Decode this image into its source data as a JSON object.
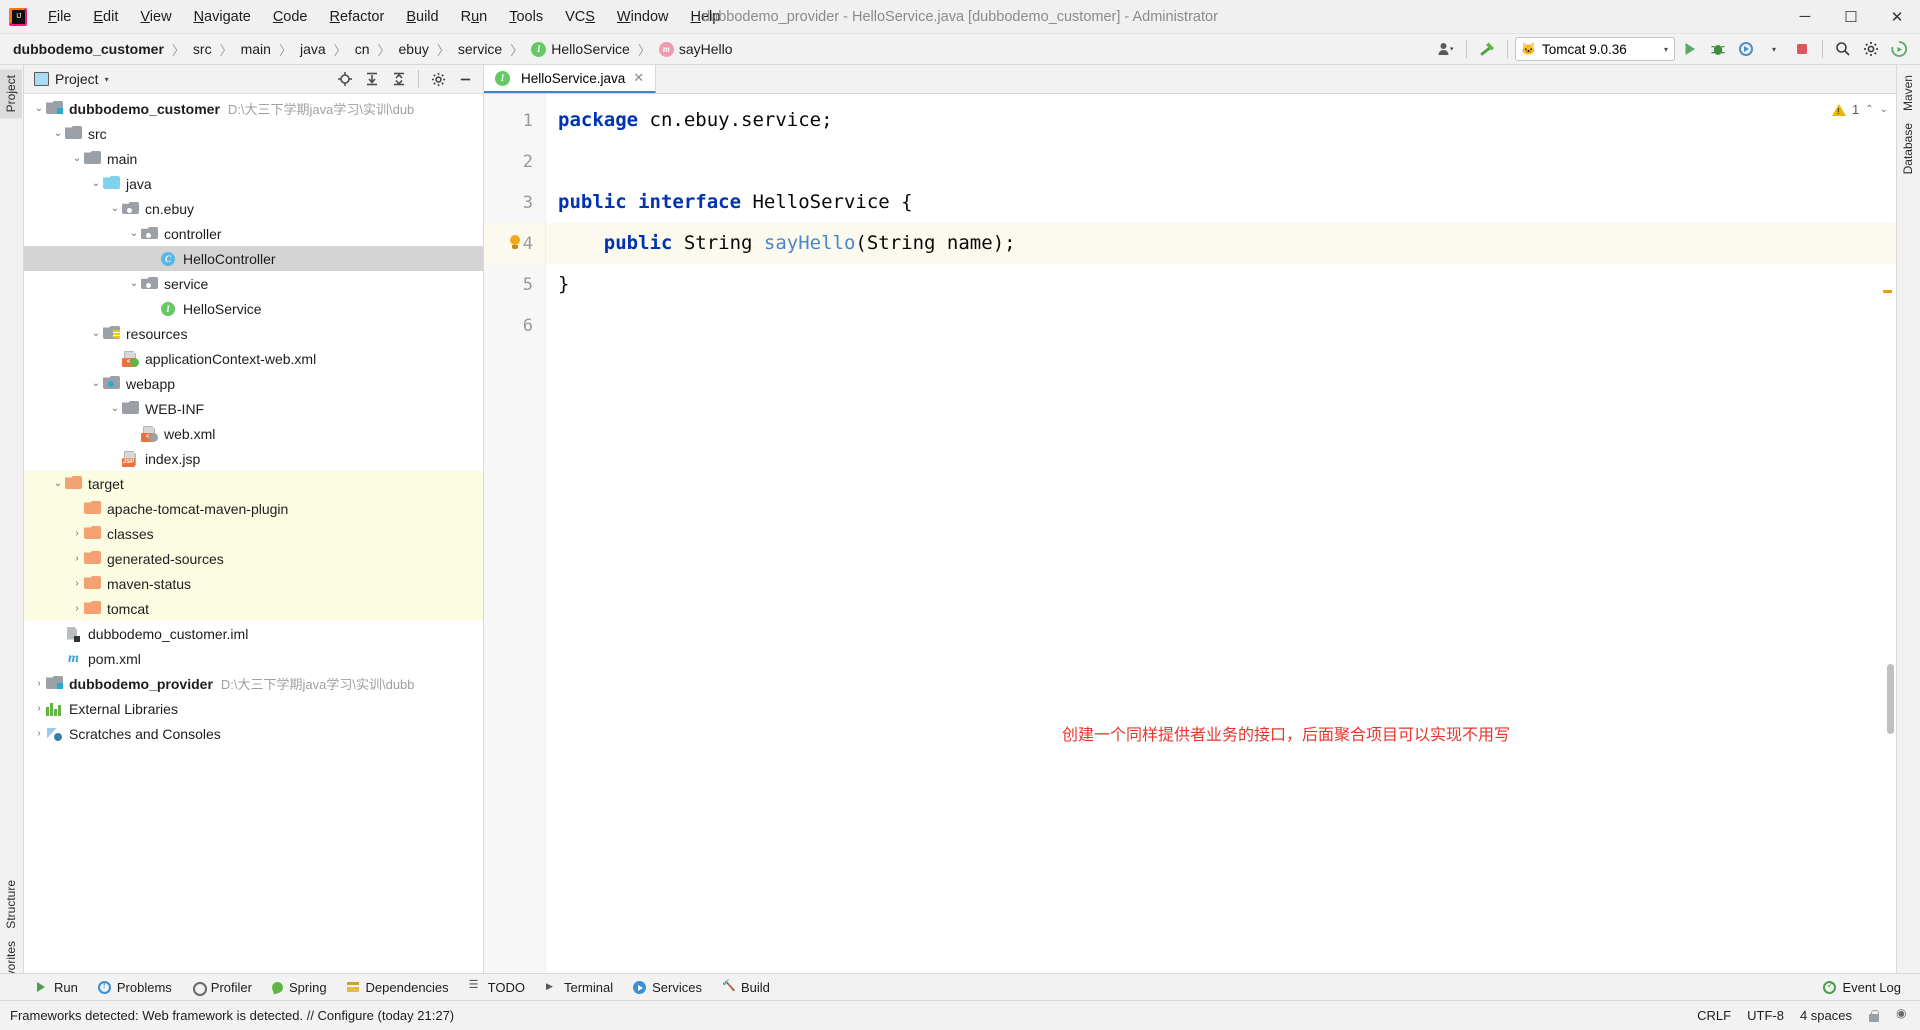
{
  "window": {
    "title": "dubbodemo_provider - HelloService.java [dubbodemo_customer] - Administrator",
    "minimize": "─",
    "maximize": "☐",
    "close": "✕"
  },
  "menu": {
    "items": [
      {
        "label": "File"
      },
      {
        "label": "Edit"
      },
      {
        "label": "View"
      },
      {
        "label": "Navigate"
      },
      {
        "label": "Code"
      },
      {
        "label": "Refactor"
      },
      {
        "label": "Build"
      },
      {
        "label": "Run"
      },
      {
        "label": "Tools"
      },
      {
        "label": "VCS"
      },
      {
        "label": "Window"
      },
      {
        "label": "Help"
      }
    ]
  },
  "breadcrumb": {
    "items": [
      {
        "label": "dubbodemo_customer",
        "bold": true,
        "icon": ""
      },
      {
        "label": "src",
        "bold": false,
        "icon": ""
      },
      {
        "label": "main",
        "bold": false,
        "icon": ""
      },
      {
        "label": "java",
        "bold": false,
        "icon": ""
      },
      {
        "label": "cn",
        "bold": false,
        "icon": ""
      },
      {
        "label": "ebuy",
        "bold": false,
        "icon": ""
      },
      {
        "label": "service",
        "bold": false,
        "icon": ""
      },
      {
        "label": "HelloService",
        "bold": false,
        "icon": "interface-badge"
      },
      {
        "label": "sayHello",
        "bold": false,
        "icon": "method-badge"
      }
    ],
    "separator": "〉"
  },
  "toolbar": {
    "user_icon": "user-icon",
    "hammer_icon": "build-hammer-icon",
    "run_config": {
      "label": "Tomcat 9.0.36",
      "icon": "tomcat-cat-icon",
      "caret": "▾"
    },
    "run_icon": "run-green-triangle-icon",
    "debug_icon": "debug-bug-icon",
    "run_with_coverage_icon": "coverage-icon",
    "profiler_caret": "▾",
    "stop_icon": "stop-square-icon",
    "search_icon": "🔍",
    "settings_icon": "⚙",
    "updates_icon": "updates-icon"
  },
  "left_strip": {
    "top_tabs": [
      {
        "label": "Project",
        "selected": true
      }
    ],
    "bottom_tabs": [
      {
        "label": "Structure"
      },
      {
        "label": "Favorites"
      }
    ]
  },
  "right_strip": {
    "tabs": [
      {
        "label": "Maven"
      },
      {
        "label": "Database"
      }
    ]
  },
  "project_panel": {
    "title": "Project",
    "title_caret": "▾",
    "header_icons": [
      "locate-target-icon",
      "expand-all-icon",
      "collapse-all-icon",
      "settings-gear-icon",
      "hide-minus-icon"
    ],
    "tree": [
      {
        "indent": 0,
        "arrow": "⌄",
        "icon": "module-folder",
        "label": "dubbodemo_customer",
        "bold": true,
        "path": "D:\\大三下学期java学习\\实训\\dub",
        "state": "normal"
      },
      {
        "indent": 1,
        "arrow": "⌄",
        "icon": "folder-gray",
        "label": "src",
        "bold": false,
        "path": "",
        "state": "normal"
      },
      {
        "indent": 2,
        "arrow": "⌄",
        "icon": "folder-gray",
        "label": "main",
        "bold": false,
        "path": "",
        "state": "normal"
      },
      {
        "indent": 3,
        "arrow": "⌄",
        "icon": "folder-blue",
        "label": "java",
        "bold": false,
        "path": "",
        "state": "normal"
      },
      {
        "indent": 4,
        "arrow": "⌄",
        "icon": "package",
        "label": "cn.ebuy",
        "bold": false,
        "path": "",
        "state": "normal"
      },
      {
        "indent": 5,
        "arrow": "⌄",
        "icon": "package",
        "label": "controller",
        "bold": false,
        "path": "",
        "state": "normal"
      },
      {
        "indent": 6,
        "arrow": "",
        "icon": "class-badge",
        "label": "HelloController",
        "bold": false,
        "path": "",
        "state": "selected"
      },
      {
        "indent": 5,
        "arrow": "⌄",
        "icon": "package",
        "label": "service",
        "bold": false,
        "path": "",
        "state": "normal"
      },
      {
        "indent": 6,
        "arrow": "",
        "icon": "interface-badge",
        "label": "HelloService",
        "bold": false,
        "path": "",
        "state": "normal"
      },
      {
        "indent": 3,
        "arrow": "⌄",
        "icon": "folder-resources",
        "label": "resources",
        "bold": false,
        "path": "",
        "state": "normal"
      },
      {
        "indent": 4,
        "arrow": "",
        "icon": "xml-spring-file",
        "label": "applicationContext-web.xml",
        "bold": false,
        "path": "",
        "state": "normal"
      },
      {
        "indent": 3,
        "arrow": "⌄",
        "icon": "folder-webapp",
        "label": "webapp",
        "bold": false,
        "path": "",
        "state": "normal"
      },
      {
        "indent": 4,
        "arrow": "⌄",
        "icon": "folder-gray",
        "label": "WEB-INF",
        "bold": false,
        "path": "",
        "state": "normal"
      },
      {
        "indent": 5,
        "arrow": "",
        "icon": "xml-web-file",
        "label": "web.xml",
        "bold": false,
        "path": "",
        "state": "normal"
      },
      {
        "indent": 4,
        "arrow": "",
        "icon": "jsp-file",
        "label": "index.jsp",
        "bold": false,
        "path": "",
        "state": "normal"
      },
      {
        "indent": 1,
        "arrow": "⌄",
        "icon": "folder-orange",
        "label": "target",
        "bold": false,
        "path": "",
        "state": "excluded"
      },
      {
        "indent": 2,
        "arrow": "",
        "icon": "folder-orange",
        "label": "apache-tomcat-maven-plugin",
        "bold": false,
        "path": "",
        "state": "excluded"
      },
      {
        "indent": 2,
        "arrow": "›",
        "icon": "folder-orange",
        "label": "classes",
        "bold": false,
        "path": "",
        "state": "excluded"
      },
      {
        "indent": 2,
        "arrow": "›",
        "icon": "folder-orange",
        "label": "generated-sources",
        "bold": false,
        "path": "",
        "state": "excluded"
      },
      {
        "indent": 2,
        "arrow": "›",
        "icon": "folder-orange",
        "label": "maven-status",
        "bold": false,
        "path": "",
        "state": "excluded"
      },
      {
        "indent": 2,
        "arrow": "›",
        "icon": "folder-orange",
        "label": "tomcat",
        "bold": false,
        "path": "",
        "state": "excluded"
      },
      {
        "indent": 1,
        "arrow": "",
        "icon": "iml-file",
        "label": "dubbodemo_customer.iml",
        "bold": false,
        "path": "",
        "state": "normal"
      },
      {
        "indent": 1,
        "arrow": "",
        "icon": "maven-m-file",
        "label": "pom.xml",
        "bold": false,
        "path": "",
        "state": "normal"
      },
      {
        "indent": 0,
        "arrow": "›",
        "icon": "module-folder",
        "label": "dubbodemo_provider",
        "bold": true,
        "path": "D:\\大三下学期java学习\\实训\\dubb",
        "state": "normal"
      },
      {
        "indent": 0,
        "arrow": "›",
        "icon": "library-icon",
        "label": "External Libraries",
        "bold": false,
        "path": "",
        "state": "normal"
      },
      {
        "indent": 0,
        "arrow": "›",
        "icon": "scratches-icon",
        "label": "Scratches and Consoles",
        "bold": false,
        "path": "",
        "state": "normal"
      }
    ]
  },
  "editor": {
    "tab": {
      "label": "HelloService.java",
      "icon": "interface-badge",
      "close": "✕"
    },
    "inspection": {
      "warning_count": "1",
      "warning_icon": "warning-triangle-icon",
      "up": "⌃",
      "down": "⌄"
    },
    "gutter_lines": [
      "1",
      "2",
      "3",
      "4",
      "5",
      "6"
    ],
    "code_lines": [
      {
        "n": 1,
        "tokens": [
          {
            "t": "package",
            "c": "kw"
          },
          {
            "t": " cn.ebuy.service;",
            "c": "plain"
          }
        ],
        "highlight": false,
        "bulb": false
      },
      {
        "n": 2,
        "tokens": [],
        "highlight": false,
        "bulb": false
      },
      {
        "n": 3,
        "tokens": [
          {
            "t": "public interface",
            "c": "kw"
          },
          {
            "t": " HelloService {",
            "c": "plain"
          }
        ],
        "highlight": false,
        "bulb": false
      },
      {
        "n": 4,
        "tokens": [
          {
            "t": "    public",
            "c": "kw"
          },
          {
            "t": " String ",
            "c": "plain"
          },
          {
            "t": "sayHello",
            "c": "meth"
          },
          {
            "t": "(String name);",
            "c": "plain"
          }
        ],
        "highlight": true,
        "bulb": true
      },
      {
        "n": 5,
        "tokens": [
          {
            "t": "}",
            "c": "plain"
          }
        ],
        "highlight": false,
        "bulb": false
      },
      {
        "n": 6,
        "tokens": [],
        "highlight": false,
        "bulb": false
      }
    ],
    "annotation": {
      "text": "创建一个同样提供者业务的接口，后面聚合项目可以实现不用写",
      "color": "#e8352b"
    }
  },
  "bottom_tool_windows": {
    "items": [
      {
        "label": "Run",
        "icon": "run-icon"
      },
      {
        "label": "Problems",
        "icon": "problems-icon"
      },
      {
        "label": "Profiler",
        "icon": "profiler-icon"
      },
      {
        "label": "Spring",
        "icon": "spring-leaf-icon"
      },
      {
        "label": "Dependencies",
        "icon": "dependencies-icon"
      },
      {
        "label": "TODO",
        "icon": "todo-icon"
      },
      {
        "label": "Terminal",
        "icon": "terminal-icon"
      },
      {
        "label": "Services",
        "icon": "services-icon"
      },
      {
        "label": "Build",
        "icon": "build-hammer-icon"
      }
    ],
    "event_log": {
      "label": "Event Log",
      "icon": "event-log-icon"
    }
  },
  "status_bar": {
    "message": "Frameworks detected: Web framework is detected. // Configure (today 21:27)",
    "line_separator": "CRLF",
    "encoding": "UTF-8",
    "indent": "4 spaces",
    "lock_icon": "lock-icon",
    "notifications_icon": "notifications-icon"
  }
}
